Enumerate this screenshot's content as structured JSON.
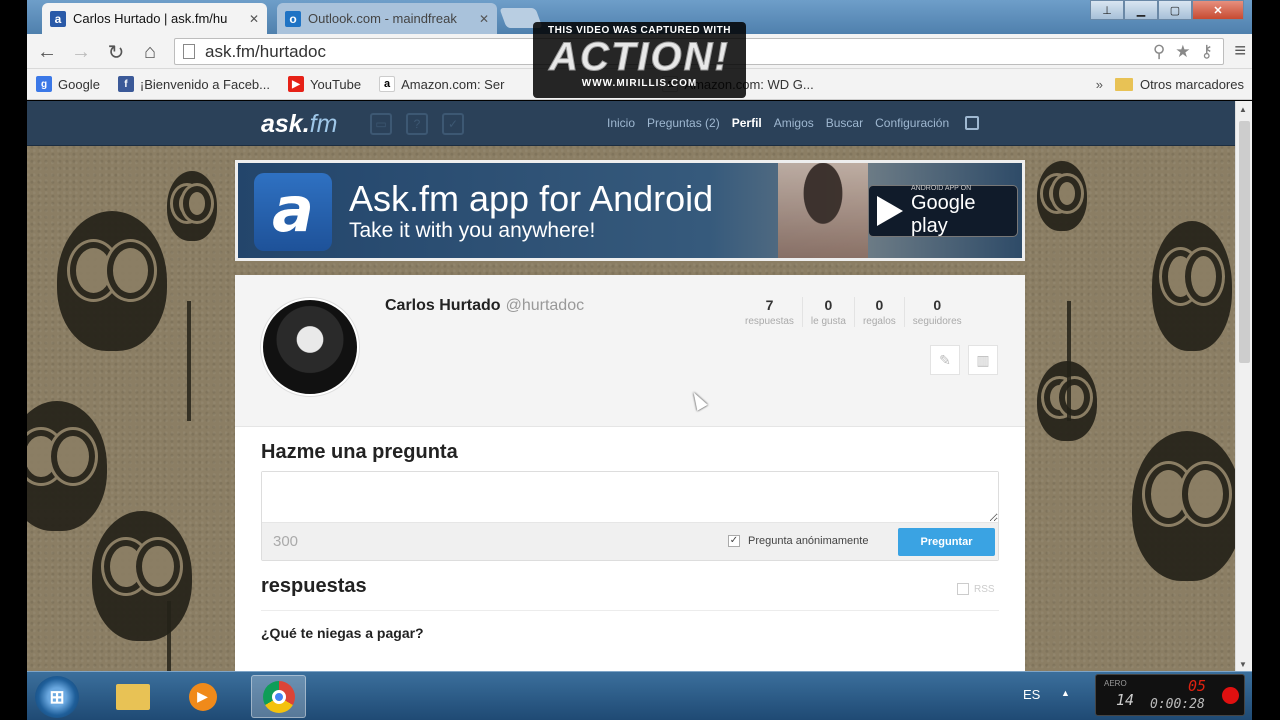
{
  "browser": {
    "tabs": [
      {
        "title": "Carlos Hurtado | ask.fm/hu",
        "icon": "askfm-icon",
        "active": true
      },
      {
        "title": "Outlook.com - maindfreak",
        "icon": "outlook-icon",
        "active": false
      }
    ],
    "url": "ask.fm/hurtadoc",
    "bookmarks": [
      {
        "label": "Google",
        "icon": "google-icon"
      },
      {
        "label": "¡Bienvenido a Faceb...",
        "icon": "facebook-icon"
      },
      {
        "label": "YouTube",
        "icon": "youtube-icon"
      },
      {
        "label": "Amazon.com: Ser",
        "icon": "amazon-icon"
      },
      {
        "label": "Amazon.com: WD G...",
        "icon": "amazon-icon"
      }
    ],
    "bookmarks_more": "»",
    "other_bookmarks": "Otros marcadores"
  },
  "watermark": {
    "top": "THIS VIDEO WAS CAPTURED WITH",
    "logo": "ACTION!",
    "url": "WWW.MIRILLIS.COM"
  },
  "site": {
    "logo_main": "ask.",
    "logo_sub": "fm",
    "nav": [
      "Inicio",
      "Preguntas (2)",
      "Perfil",
      "Amigos",
      "Buscar",
      "Configuración"
    ],
    "active_nav": "Perfil"
  },
  "banner": {
    "title": "Ask.fm app for Android",
    "subtitle": "Take it with you anywhere!",
    "icon_letter": "a",
    "store_small": "ANDROID APP ON",
    "store_name": "Google play"
  },
  "profile": {
    "name": "Carlos Hurtado",
    "username": "@hurtadoc",
    "stats": [
      {
        "value": "7",
        "label": "respuestas"
      },
      {
        "value": "0",
        "label": "le gusta"
      },
      {
        "value": "0",
        "label": "regalos"
      },
      {
        "value": "0",
        "label": "seguidores"
      }
    ]
  },
  "ask": {
    "heading": "Hazme una pregunta",
    "char_count": "300",
    "anonymous_label": "Pregunta anónimamente",
    "anonymous_checked": true,
    "submit_label": "Preguntar"
  },
  "answers": {
    "heading": "respuestas",
    "rss": "RSS",
    "first_question": "¿Qué te niegas a pagar?"
  },
  "taskbar": {
    "language": "ES",
    "recorder_label": "AERO",
    "recorder_fps": "14",
    "recorder_count": "05",
    "recorder_time": "0:00:28"
  },
  "colors": {
    "nav_bg": "#2b4159",
    "ask_button": "#3aa3e3",
    "record_dot": "#e01010"
  }
}
